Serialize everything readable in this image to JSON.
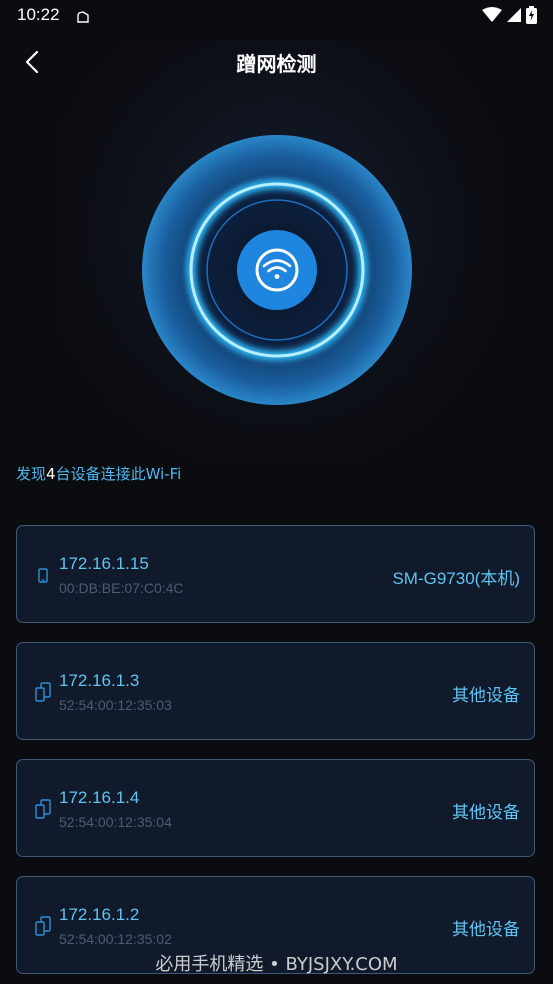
{
  "status_bar": {
    "time": "10:22"
  },
  "header": {
    "title": "蹭网检测"
  },
  "summary": {
    "prefix": "发现",
    "count": "4",
    "suffix": "台设备连接此Wi-Fi"
  },
  "devices": [
    {
      "ip": "172.16.1.15",
      "mac": "00:DB:BE:07:C0:4C",
      "name": "SM-G9730(本机)",
      "icon": "phone-icon"
    },
    {
      "ip": "172.16.1.3",
      "mac": "52:54:00:12:35:03",
      "name": "其他设备",
      "icon": "devices-icon"
    },
    {
      "ip": "172.16.1.4",
      "mac": "52:54:00:12:35:04",
      "name": "其他设备",
      "icon": "devices-icon"
    },
    {
      "ip": "172.16.1.2",
      "mac": "52:54:00:12:35:02",
      "name": "其他设备",
      "icon": "devices-icon"
    }
  ],
  "watermark": "必用手机精选 • BYJSJXY.COM",
  "colors": {
    "background": "#0b0c10",
    "accent": "#5fc4f3",
    "card_border": "#3f5877",
    "mac_text": "#4a5d75"
  }
}
